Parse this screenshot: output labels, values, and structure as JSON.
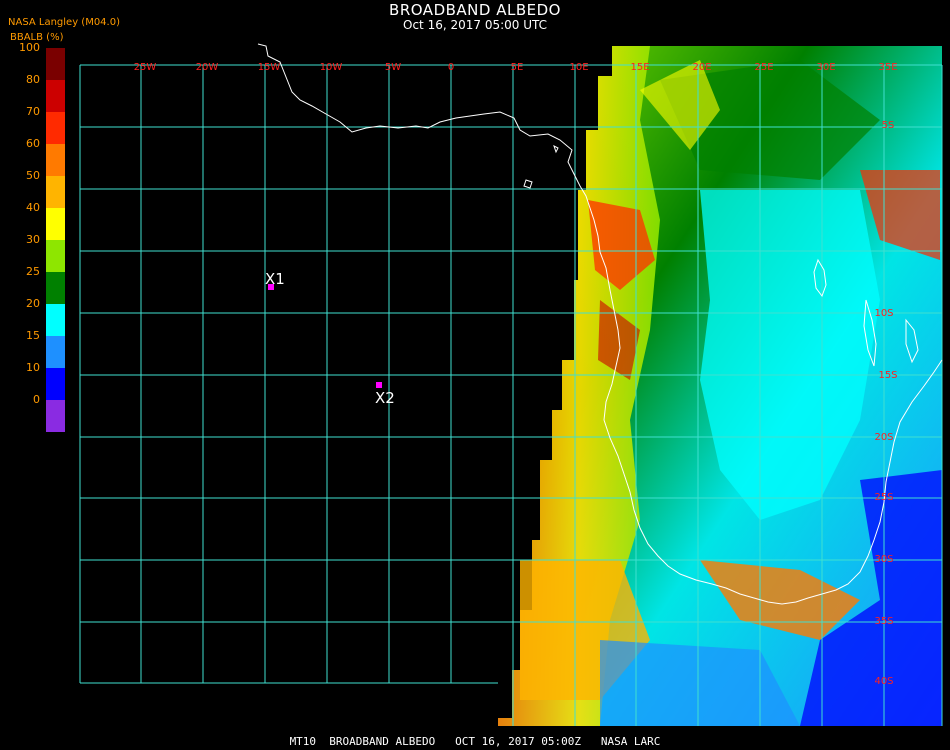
{
  "header": {
    "title": "BROADBAND ALBEDO",
    "subtitle": "Oct 16, 2017 05:00 UTC",
    "producer": "NASA Langley (M04.0)"
  },
  "legend": {
    "title": "BBALB (%)",
    "ticks": [
      "100",
      "80",
      "70",
      "60",
      "50",
      "40",
      "30",
      "25",
      "20",
      "15",
      "10",
      "0"
    ],
    "colors": [
      "#ff9a00",
      "#7a0000",
      "#cc0000",
      "#ff2a00",
      "#ff7a00",
      "#ffb400",
      "#ffff00",
      "#8ee600",
      "#008000",
      "#00ffff",
      "#1e90ff",
      "#0000ff",
      "#8a2be2"
    ]
  },
  "grid": {
    "lon_labels": [
      "25W",
      "20W",
      "15W",
      "10W",
      "5W",
      "0",
      "5E",
      "10E",
      "15E",
      "20E",
      "25E",
      "30E",
      "35E"
    ],
    "lat_labels": [
      "5S",
      "10S",
      "15S",
      "20S",
      "25S",
      "30S",
      "35S",
      "40S"
    ],
    "line_color": "#40e0d0",
    "label_color": "#ff2020"
  },
  "markers": [
    {
      "label": "X1",
      "color": "#ff00ff"
    },
    {
      "label": "X2",
      "color": "#ff00ff"
    }
  ],
  "footer": "MT10  BROADBAND ALBEDO   OCT 16, 2017 05:00Z   NASA LARC"
}
